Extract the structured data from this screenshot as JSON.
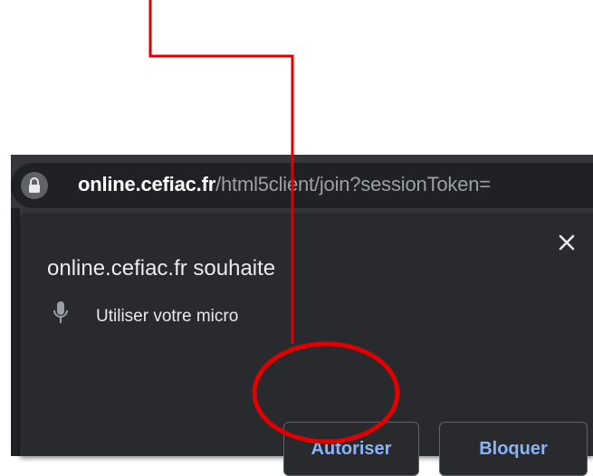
{
  "address_bar": {
    "host": "online.cefiac.fr",
    "path": "/html5client/join?sessionToken=",
    "lock_icon": "lock-icon"
  },
  "permission_prompt": {
    "title": "online.cefiac.fr souhaite",
    "permission_text": "Utiliser votre micro",
    "permission_icon": "microphone-icon",
    "close_icon": "close-icon",
    "allow_label": "Autoriser",
    "block_label": "Bloquer"
  },
  "annotation": {
    "color": "#e00000",
    "shapes": [
      "arrow-line",
      "highlight-circle"
    ]
  },
  "colors": {
    "chrome_dark": "#202124",
    "popup_bg": "#292a2d",
    "button_text": "#8ab4f8"
  }
}
